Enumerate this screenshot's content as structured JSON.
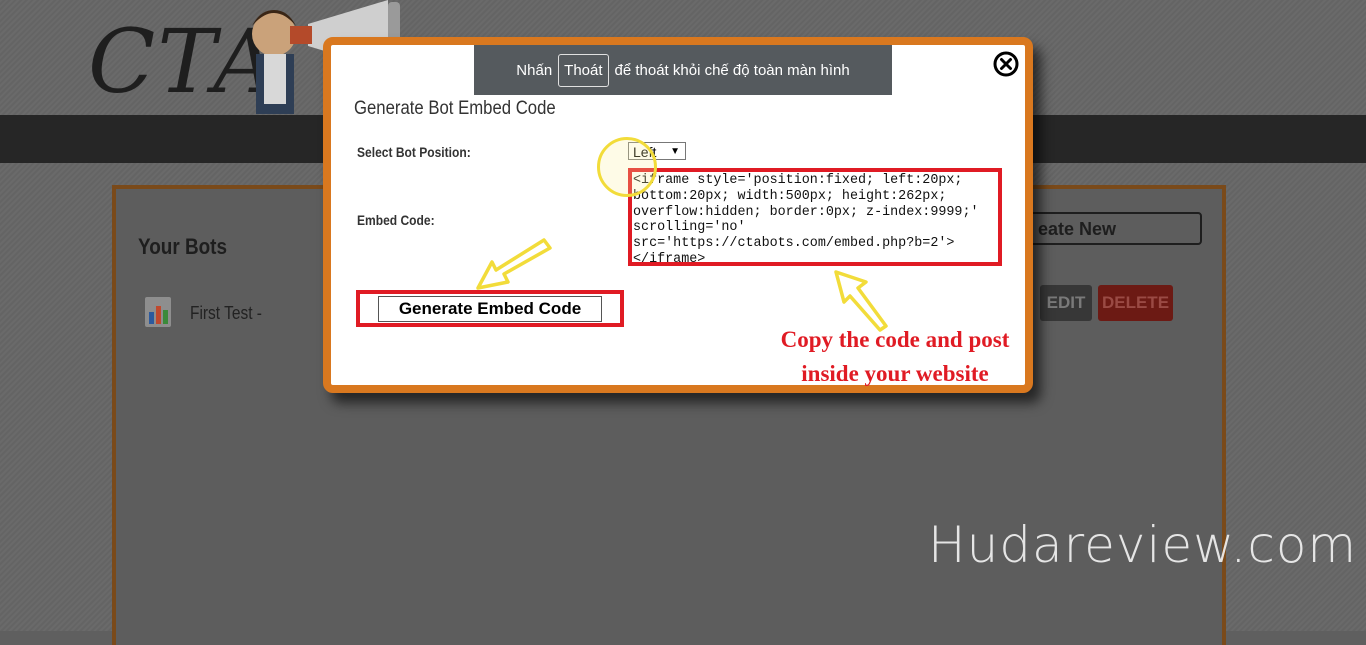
{
  "background": {
    "logo_text": "CTA",
    "panel_title": "Your Bots",
    "bot_name": "First Test -",
    "create_button_label": "eate New",
    "edit_button_label": "EDIT",
    "delete_button_label": "DELETE",
    "watermark": "Hudareview.com"
  },
  "fullscreen_banner": {
    "prefix": "Nhấn",
    "key": "Thoát",
    "suffix": "để thoát khỏi chế độ toàn màn hình"
  },
  "modal": {
    "title": "Generate Bot Embed Code",
    "position_label": "Select Bot Position:",
    "position_value": "Left",
    "embed_label": "Embed Code:",
    "embed_code": "<iframe style='position:fixed; left:20px;\nbottom:20px; width:500px; height:262px;\noverflow:hidden; border:0px; z-index:9999;'\nscrolling='no'\nsrc='https://ctabots.com/embed.php?b=2'>\n</iframe>",
    "generate_button_label": "Generate Embed Code",
    "annotation_line1": "Copy the code and post",
    "annotation_line2": "inside your website"
  },
  "colors": {
    "modal_border": "#d9781f",
    "highlight_red": "#e01b24",
    "arrow_yellow": "#f2dc3a",
    "header_bar": "#262626"
  }
}
